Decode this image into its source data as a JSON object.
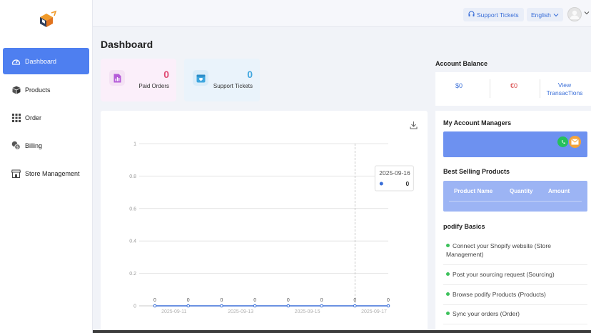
{
  "sidebar": {
    "items": [
      {
        "label": "Dashboard",
        "icon": "dashboard-gauge-icon",
        "active": true
      },
      {
        "label": "Products",
        "icon": "box-icon"
      },
      {
        "label": "Order",
        "icon": "grid-icon"
      },
      {
        "label": "Billing",
        "icon": "billing-coins-icon"
      },
      {
        "label": "Store Management",
        "icon": "store-icon"
      }
    ]
  },
  "topbar": {
    "support_label": "Support Tickets",
    "language_label": "English"
  },
  "page": {
    "title": "Dashboard"
  },
  "stats": {
    "paid_orders": {
      "value": "0",
      "label": "Paid Orders"
    },
    "support_tickets": {
      "value": "0",
      "label": "Support Tickets"
    }
  },
  "chart_data": {
    "type": "line",
    "x": [
      "2025-09-10",
      "2025-09-11",
      "2025-09-12",
      "2025-09-13",
      "2025-09-14",
      "2025-09-15",
      "2025-09-16",
      "2025-09-17"
    ],
    "x_tick_labels": [
      "2025-09-11",
      "2025-09-13",
      "2025-09-15",
      "2025-09-17"
    ],
    "series": [
      {
        "values": [
          0,
          0,
          0,
          0,
          0,
          0,
          0,
          0
        ],
        "color": "#3a6fd8"
      }
    ],
    "data_labels": [
      "0",
      "0",
      "0",
      "0",
      "0",
      "0",
      "0",
      "0"
    ],
    "y_ticks": [
      "0",
      "0.2",
      "0.4",
      "0.6",
      "0.8",
      "1"
    ],
    "ylim": [
      0,
      1
    ],
    "grid": true,
    "tooltip": {
      "date": "2025-09-16",
      "value": "0"
    }
  },
  "account_balance": {
    "title": "Account Balance",
    "usd": "$0",
    "eur": "€0",
    "view_transactions": "View TransacTions"
  },
  "managers": {
    "title": "My Account Managers"
  },
  "best_selling": {
    "title": "Best Selling Products",
    "columns": [
      "Product Name",
      "Quantity",
      "Amount"
    ]
  },
  "basics": {
    "title": "podify Basics",
    "items": [
      "Connect your Shopify website (Store Management)",
      "Post your sourcing request (Sourcing)",
      "Browse podify Products (Products)",
      "Sync your orders (Order)"
    ]
  },
  "colors": {
    "accent": "#4e7ff0",
    "orders": "#e04a73",
    "tickets": "#3ea6df",
    "manager_bar": "#6d91f0"
  }
}
